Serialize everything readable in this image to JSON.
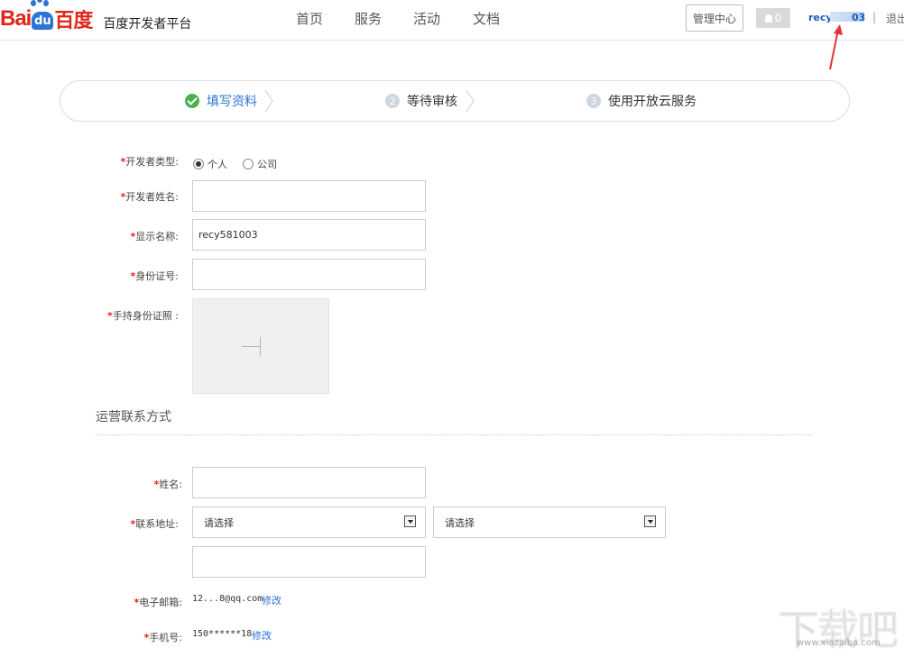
{
  "header": {
    "logo_bai": "Bai",
    "logo_du": "du",
    "logo_cn": "百度",
    "platform_name": "百度开发者平台",
    "nav": [
      "首页",
      "服务",
      "活动",
      "文档"
    ],
    "manage_label": "管理中心",
    "msg_count": "0",
    "username": "recy",
    "username_suffix": "03",
    "separator": "|",
    "logout_label": "退出"
  },
  "steps": [
    {
      "num": "",
      "label": "填写资料",
      "state": "done",
      "color": "#2d73d8"
    },
    {
      "num": "2",
      "label": "等待审核",
      "state": "pending"
    },
    {
      "num": "3",
      "label": "使用开放云服务",
      "state": "pending"
    }
  ],
  "form": {
    "dev_type": {
      "label": "开发者类型:",
      "options": [
        "个人",
        "公司"
      ],
      "selected": "个人"
    },
    "dev_name": {
      "label": "开发者姓名:",
      "value": ""
    },
    "display_name": {
      "label": "显示名称:",
      "value": "recy581003"
    },
    "id_number": {
      "label": "身份证号:",
      "value": ""
    },
    "id_photo": {
      "label": "手持身份证照 :"
    }
  },
  "contact": {
    "section_title": "运营联系方式",
    "name": {
      "label": "姓名:",
      "value": ""
    },
    "address": {
      "label": "联系地址:",
      "select1": "请选择",
      "select2": "请选择",
      "detail": ""
    },
    "email": {
      "label": "电子邮箱:",
      "value": "12...8@qq.com",
      "edit": "修改"
    },
    "phone": {
      "label": "手机号:",
      "value": "150******18",
      "edit": "修改"
    }
  },
  "required_mark": "*",
  "watermark": {
    "text": "下载吧",
    "url": "www.xiazaiba.com"
  },
  "colors": {
    "brand_red": "#e1251b",
    "brand_blue": "#2d73d8",
    "success_green": "#4caf50"
  }
}
